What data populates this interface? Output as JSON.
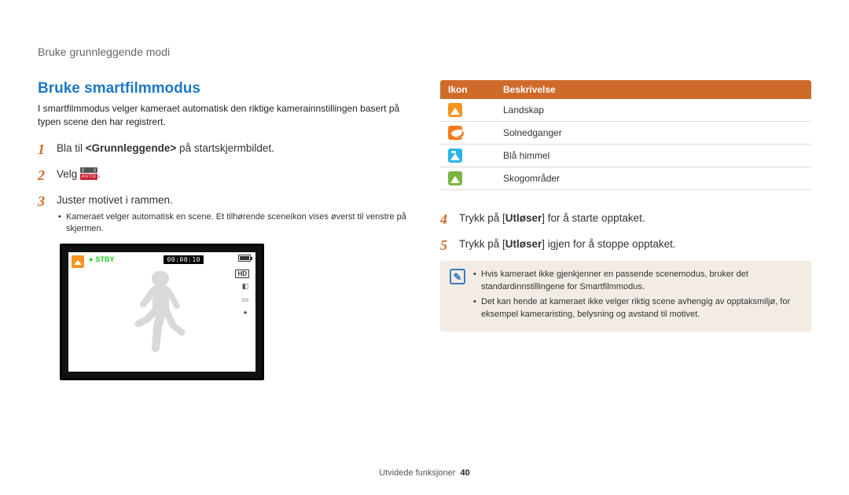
{
  "chapter": "Bruke grunnleggende modi",
  "section_title": "Bruke smartfilmmodus",
  "intro": "I smartfilmmodus velger kameraet automatisk den riktige kamerainnstillingen basert på typen scene den har registrert.",
  "steps": {
    "1": {
      "pre": "Bla til ",
      "bold": "<Grunnleggende>",
      "post": " på startskjermbildet."
    },
    "2": {
      "pre": "Velg ",
      "icon_alt": "AUTO",
      "post": "."
    },
    "3": {
      "text": "Juster motivet i rammen.",
      "sub": "Kameraet velger automatisk en scene. Et tilhørende sceneikon vises øverst til venstre på skjermen."
    },
    "4": {
      "pre": "Trykk på [",
      "bold": "Utløser",
      "post": "] for å starte opptaket."
    },
    "5": {
      "pre": "Trykk på [",
      "bold": "Utløser",
      "post": "] igjen for å stoppe opptaket."
    }
  },
  "preview": {
    "rec_label": "STBY",
    "timer": "00:00:10",
    "hd": "HD"
  },
  "table": {
    "head_icon": "Ikon",
    "head_desc": "Beskrivelse",
    "rows": [
      {
        "icon": "ic-orange",
        "name": "landscape-icon",
        "label": "Landskap"
      },
      {
        "icon": "ic-orange2",
        "name": "sunset-icon",
        "label": "Solnedganger"
      },
      {
        "icon": "ic-cyan",
        "name": "blue-sky-icon",
        "label": "Blå himmel"
      },
      {
        "icon": "ic-green",
        "name": "forest-icon",
        "label": "Skogområder"
      }
    ]
  },
  "notes": [
    "Hvis kameraet ikke gjenkjenner en passende scenemodus, bruker det standardinnstillingene for Smartfilmmodus.",
    "Det kan hende at kameraet ikke velger riktig scene avhengig av opptaksmiljø, for eksempel kameraristing, belysning og avstand til motivet."
  ],
  "footer": {
    "section": "Utvidede funksjoner",
    "page": "40"
  }
}
